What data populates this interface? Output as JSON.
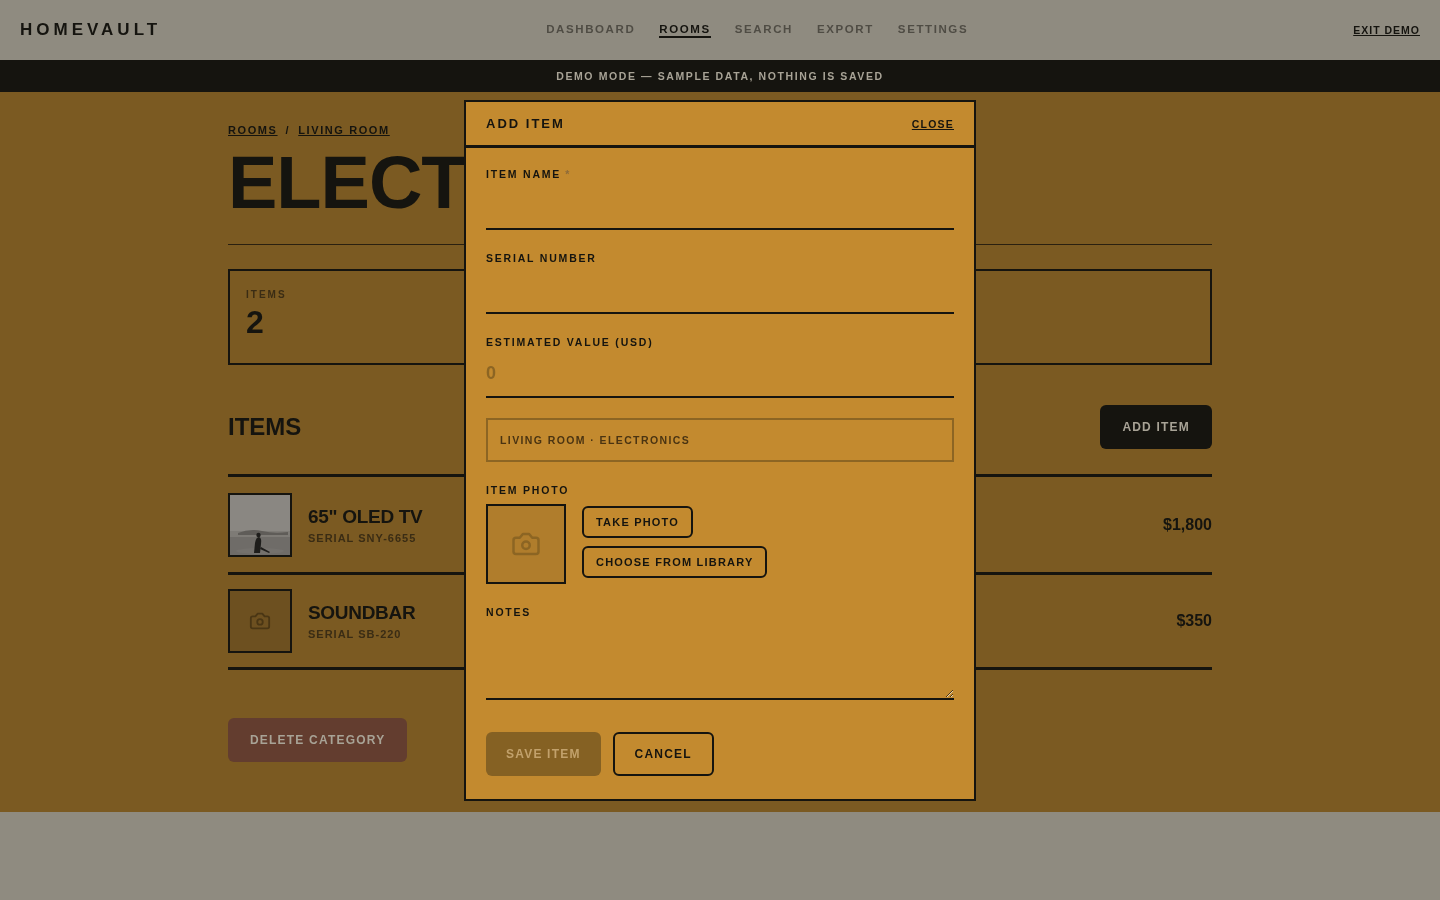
{
  "brand": "HOMEVAULT",
  "nav": [
    {
      "label": "DASHBOARD",
      "selected": false
    },
    {
      "label": "ROOMS",
      "selected": true
    },
    {
      "label": "SEARCH",
      "selected": false
    },
    {
      "label": "EXPORT",
      "selected": false
    },
    {
      "label": "SETTINGS",
      "selected": false
    }
  ],
  "exit_link": "EXIT DEMO",
  "banner": "DEMO MODE — SAMPLE DATA, NOTHING IS SAVED",
  "breadcrumb": [
    "ROOMS",
    "LIVING ROOM"
  ],
  "breadcrumb_separator": "/",
  "title": "ELECT",
  "stats": [
    {
      "label": "ITEMS",
      "value": "2"
    }
  ],
  "items_heading": "ITEMS",
  "add_button": "ADD ITEM",
  "items": [
    {
      "name": "65\" OLED TV",
      "serial": "SERIAL SNY-6655",
      "value": "$1,800",
      "kind": "picture"
    },
    {
      "name": "SOUNDBAR",
      "serial": "SERIAL SB-220",
      "value": "$350",
      "kind": "placeholder"
    }
  ],
  "delete_button": "DELETE CATEGORY",
  "modal": {
    "title": "ADD ITEM",
    "close": "CLOSE",
    "fields": [
      {
        "label": "ITEM NAME",
        "required_mark": "*"
      },
      {
        "label": "SERIAL NUMBER"
      },
      {
        "label": "ESTIMATED VALUE (USD)",
        "placeholder": "0"
      }
    ],
    "location_tag": "LIVING ROOM · ELECTRONICS",
    "photo": {
      "label": "ITEM PHOTO",
      "buttons": [
        "TAKE PHOTO",
        "CHOOSE FROM LIBRARY"
      ]
    },
    "notes": {
      "label": "NOTES"
    },
    "buttons": [
      {
        "label": "SAVE ITEM",
        "kind": "primary",
        "disabled": true
      },
      {
        "label": "CANCEL",
        "kind": "secondary",
        "disabled": false
      }
    ]
  }
}
